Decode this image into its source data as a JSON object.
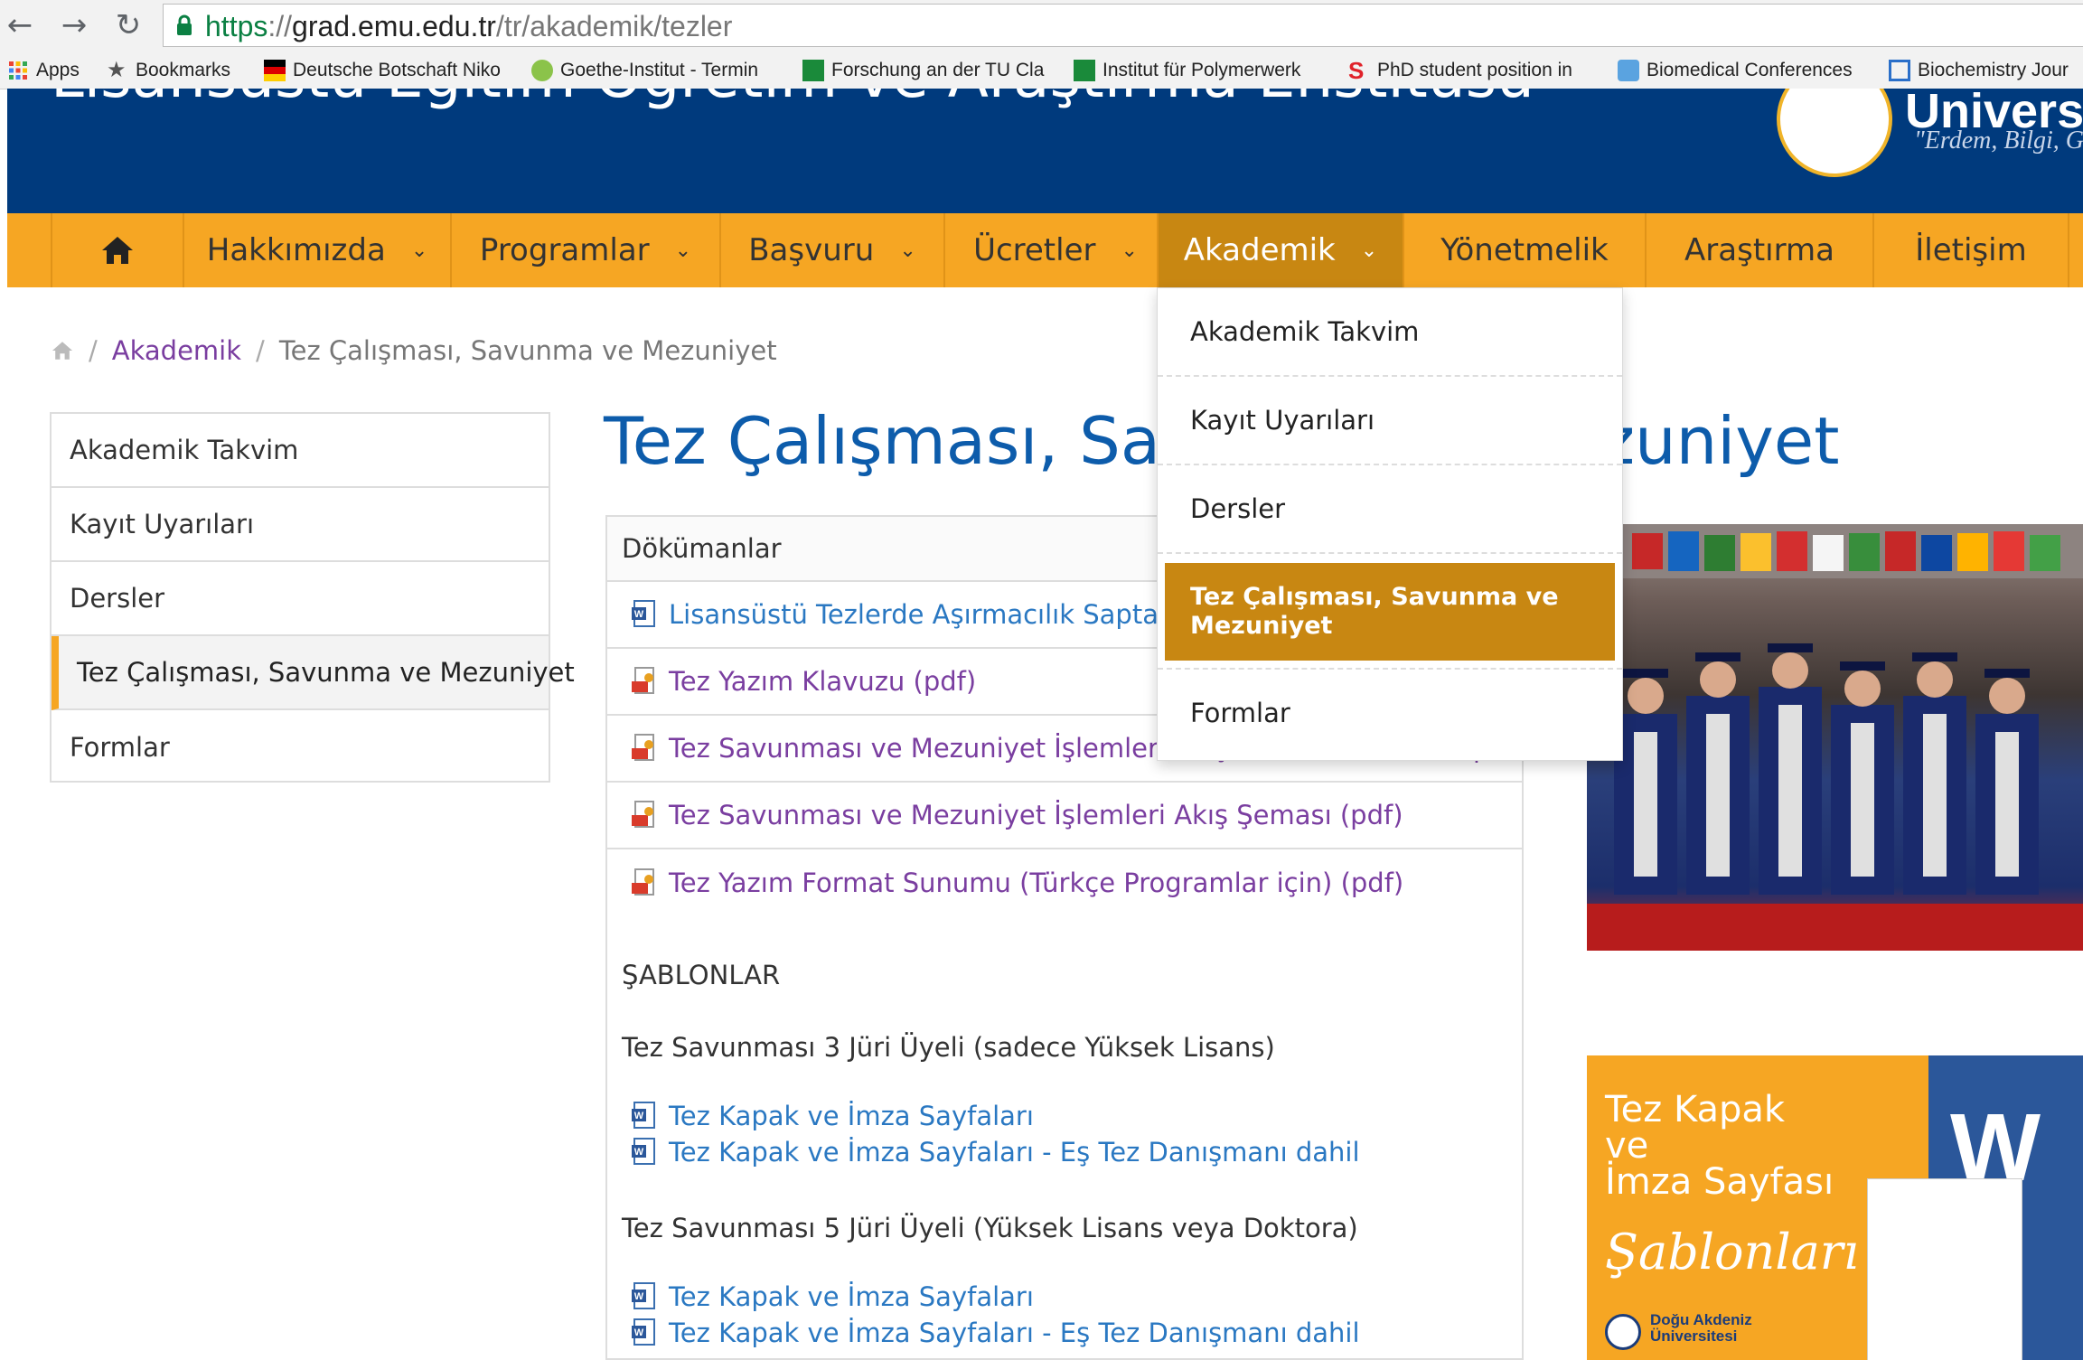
{
  "browser": {
    "url_scheme": "https",
    "url_sep": "://",
    "url_host": "grad.emu.edu.tr",
    "url_path": "/tr/akademik/tezler",
    "bookmarks": [
      "Apps",
      "Bookmarks",
      "Deutsche Botschaft Niko",
      "Goethe-Institut - Termin",
      "Forschung an der TU Cla",
      "Institut für Polymerwerk",
      "PhD student position in",
      "Biomedical Conferences",
      "Biochemistry Jour"
    ]
  },
  "header": {
    "site_title": "Lisansüstü Eğitim Öğretim ve Araştırma Enstitüsü",
    "university_name": "Univers",
    "motto": "\"Erdem, Bilgi, Gelişim\""
  },
  "nav": {
    "items": [
      "Hakkımızda",
      "Programlar",
      "Başvuru",
      "Ücretler",
      "Akademik",
      "Yönetmelik",
      "Araştırma",
      "İletişim"
    ],
    "active_index": 4
  },
  "breadcrumb": {
    "section": "Akademik",
    "current": "Tez Çalışması, Savunma ve Mezuniyet"
  },
  "sidebar": {
    "items": [
      "Akademik Takvim",
      "Kayıt Uyarıları",
      "Dersler",
      "Tez Çalışması, Savunma ve Mezuniyet",
      "Formlar"
    ],
    "active_index": 3
  },
  "page_title": "Tez Çalışması, Savunma ve Mezuniyet",
  "documents": {
    "header": "Dökümanlar",
    "items": [
      {
        "label": "Lisansüstü Tezlerde Aşırmacılık Saptama",
        "type": "word"
      },
      {
        "label": "Tez Yazım Klavuzu (pdf)",
        "type": "pdf"
      },
      {
        "label": "Tez Savunması ve Mezuniyet İşlemleri Sıkça Sorulan Sorular (pdf)",
        "type": "pdf"
      },
      {
        "label": "Tez Savunması ve Mezuniyet İşlemleri Akış Şeması (pdf)",
        "type": "pdf"
      },
      {
        "label": "Tez Yazım Format Sunumu (Türkçe Programlar için) (pdf)",
        "type": "pdf"
      }
    ]
  },
  "templates": {
    "heading": "ŞABLONLAR",
    "group1": {
      "title": "Tez Savunması 3 Jüri Üyeli (sadece Yüksek Lisans)",
      "links": [
        "Tez Kapak ve İmza Sayfaları",
        "Tez Kapak ve İmza Sayfaları - Eş Tez Danışmanı dahil"
      ]
    },
    "group2": {
      "title": "Tez Savunması 5 Jüri Üyeli (Yüksek Lisans veya Doktora)",
      "links": [
        "Tez Kapak ve İmza Sayfaları",
        "Tez Kapak ve İmza Sayfaları - Eş Tez Danışmanı dahil"
      ]
    }
  },
  "dropdown": {
    "items": [
      "Akademik Takvim",
      "Kayıt Uyarıları",
      "Dersler",
      "Tez Çalışması, Savunma ve Mezuniyet",
      "Formlar"
    ],
    "active_index": 3
  },
  "banner": {
    "line1": "Tez Kapak",
    "line2": "ve",
    "line3": "İmza Sayfası",
    "line4": "Şablonları",
    "word_letter": "W",
    "logo_line1": "Doğu Akdeniz",
    "logo_line2": "Üniversitesi"
  },
  "colors": {
    "header_blue": "#003a7d",
    "nav_orange": "#f6a623",
    "nav_active": "#c88712",
    "title_blue": "#0d5cab",
    "link_purple": "#7a3ea0",
    "link_blue": "#2a78c2"
  }
}
